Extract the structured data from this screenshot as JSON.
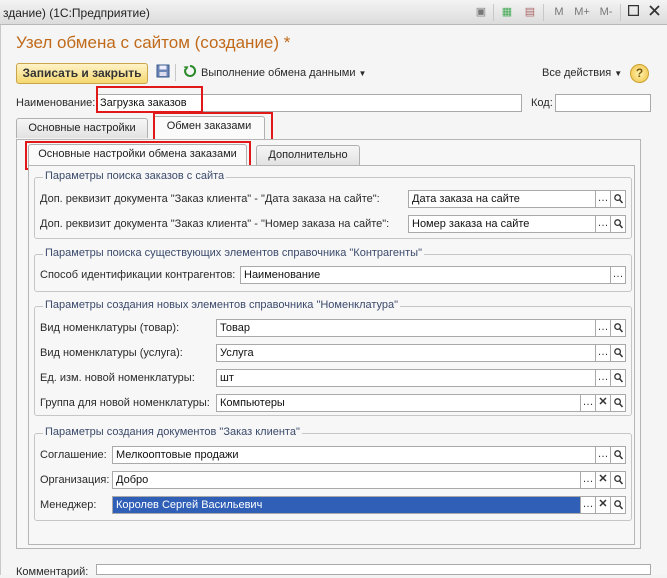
{
  "window": {
    "title": "здание)  (1С:Предприятие)",
    "memory_buttons": [
      "M",
      "M+",
      "M-"
    ]
  },
  "form": {
    "title": "Узел обмена с сайтом (создание) *"
  },
  "toolbar": {
    "save_close_label": "Записать и закрыть",
    "exchange_label": "Выполнение обмена данными",
    "all_actions_label": "Все действия",
    "help_label": "?"
  },
  "header": {
    "name_label": "Наименование:",
    "name_value": "Загрузка заказов",
    "code_label": "Код:",
    "code_value": ""
  },
  "tabs": {
    "main": [
      {
        "label": "Основные настройки"
      },
      {
        "label": "Обмен заказами"
      }
    ],
    "sub": [
      {
        "label": "Основные настройки обмена заказами"
      },
      {
        "label": "Дополнительно"
      }
    ]
  },
  "groups": {
    "order_search": {
      "title": "Параметры поиска заказов с сайта",
      "date_label": "Доп. реквизит документа \"Заказ клиента\" - \"Дата заказа на сайте\":",
      "date_value": "Дата заказа на сайте",
      "number_label": "Доп. реквизит документа \"Заказ клиента\" - \"Номер заказа на сайте\":",
      "number_value": "Номер заказа на сайте"
    },
    "counterparties": {
      "title": "Параметры поиска существующих элементов справочника \"Контрагенты\"",
      "method_label": "Способ идентификации контрагентов:",
      "method_value": "Наименование"
    },
    "nomenclature": {
      "title": "Параметры создания новых элементов справочника \"Номенклатура\"",
      "goods_label": "Вид номенклатуры (товар):",
      "goods_value": "Товар",
      "service_label": "Вид номенклатуры (услуга):",
      "service_value": "Услуга",
      "unit_label": "Ед. изм. новой номенклатуры:",
      "unit_value": "шт",
      "group_label": "Группа для новой номенклатуры:",
      "group_value": "Компьютеры"
    },
    "orders": {
      "title": "Параметры создания документов \"Заказ клиента\"",
      "agreement_label": "Соглашение:",
      "agreement_value": "Мелкооптовые продажи",
      "org_label": "Организация:",
      "org_value": "Добро",
      "manager_label": "Менеджер:",
      "manager_value": "Королев Сергей Васильевич"
    }
  },
  "footer": {
    "comment_label": "Комментарий:"
  },
  "colors": {
    "title_orange": "#c06a1a",
    "highlight_red": "#e01818",
    "selection_blue": "#2f5fb7"
  }
}
